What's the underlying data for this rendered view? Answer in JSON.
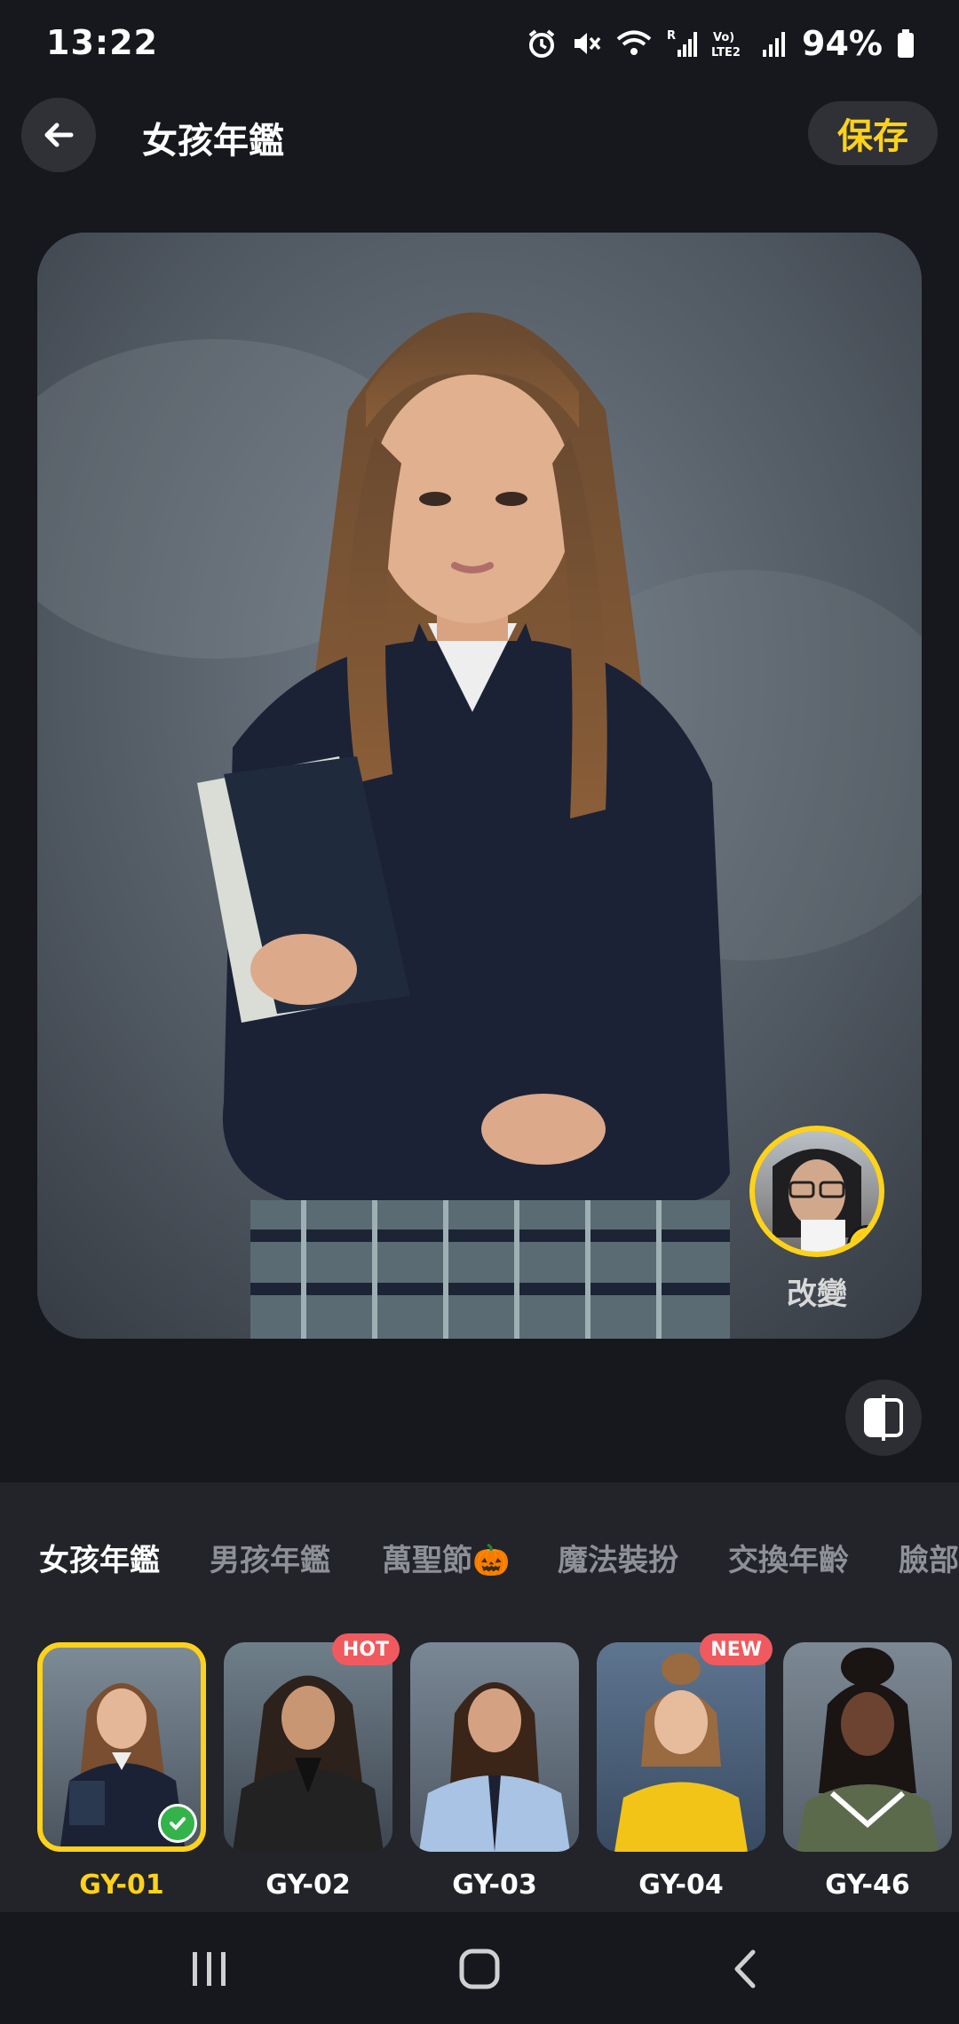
{
  "status_bar": {
    "time": "13:22",
    "battery": "94%",
    "icons": [
      "alarm-icon",
      "mute-icon",
      "wifi-icon",
      "signal-icon",
      "volte-icon",
      "signal-icon",
      "battery-icon"
    ]
  },
  "header": {
    "title": "女孩年鑑",
    "save_label": "保存"
  },
  "preview": {
    "change_face_label": "改變"
  },
  "tabs": [
    {
      "label": "女孩年鑑",
      "active": true
    },
    {
      "label": "男孩年鑑",
      "active": false
    },
    {
      "label": "萬聖節🎃",
      "active": false
    },
    {
      "label": "魔法裝扮",
      "active": false
    },
    {
      "label": "交換年齡",
      "active": false
    },
    {
      "label": "臉部",
      "active": false
    }
  ],
  "templates": [
    {
      "label": "GY-01",
      "badge": "",
      "selected": true
    },
    {
      "label": "GY-02",
      "badge": "HOT",
      "selected": false
    },
    {
      "label": "GY-03",
      "badge": "",
      "selected": false
    },
    {
      "label": "GY-04",
      "badge": "NEW",
      "selected": false
    },
    {
      "label": "GY-46",
      "badge": "",
      "selected": false
    }
  ],
  "colors": {
    "accent": "#ffd21a",
    "background": "#16181e",
    "panel": "#22242a",
    "badge_red": "#f05a5e",
    "check_green": "#34b34a"
  }
}
